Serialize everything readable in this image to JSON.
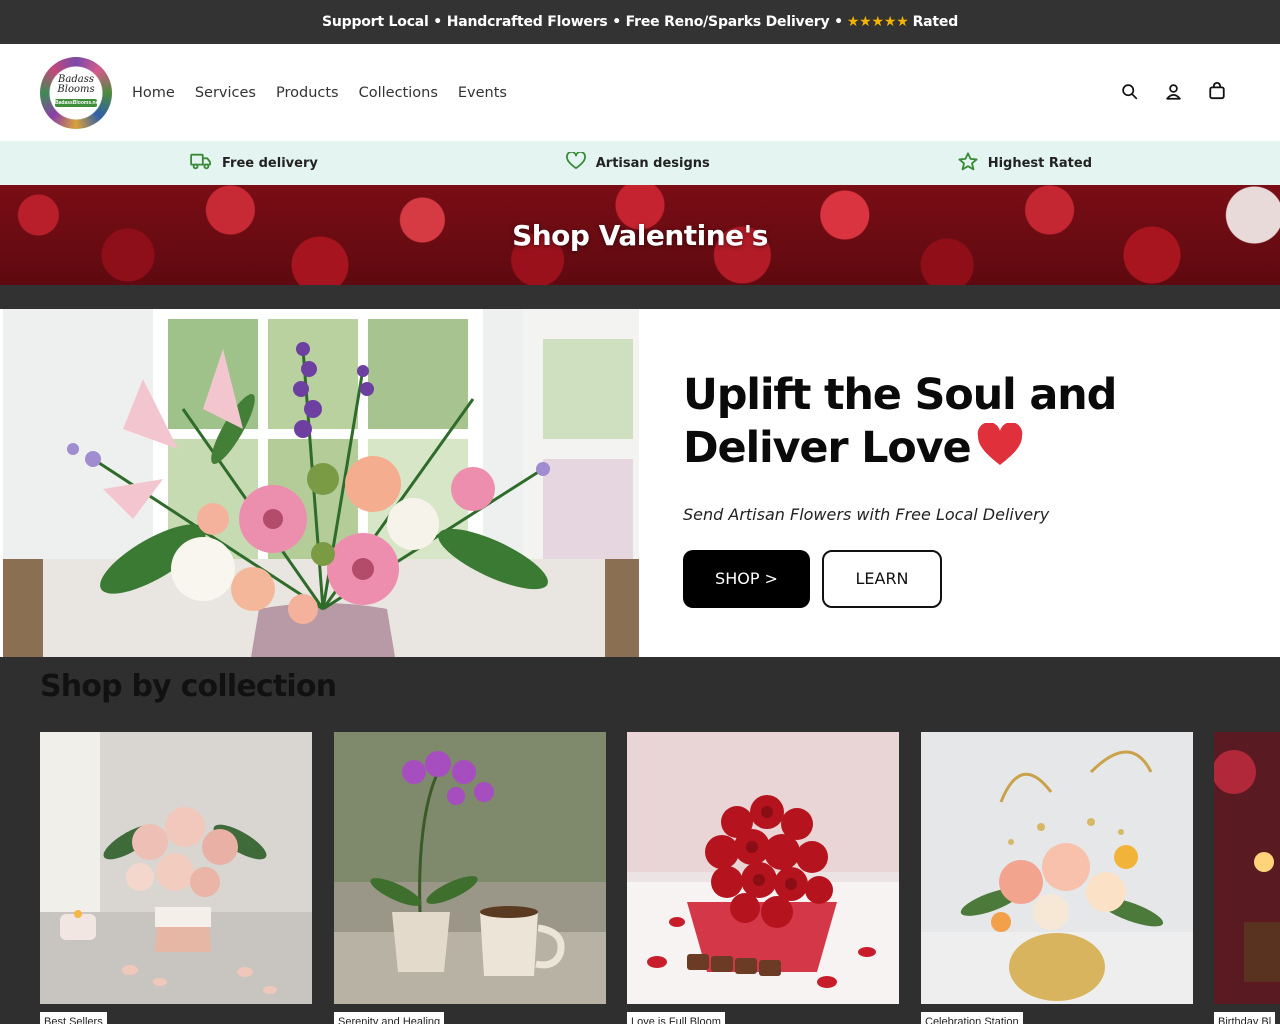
{
  "announcement": {
    "text_before": "Support Local • Handcrafted Flowers • Free Reno/Sparks Delivery •",
    "stars": "★★★★★",
    "text_after": "Rated"
  },
  "logo": {
    "line1": "Badass",
    "line2": "Blooms",
    "tag": "BadassBlooms.net"
  },
  "nav": {
    "items": [
      "Home",
      "Services",
      "Products",
      "Collections",
      "Events"
    ]
  },
  "header_icons": [
    "search-icon",
    "account-icon",
    "cart-icon"
  ],
  "features": [
    {
      "icon": "truck-icon",
      "label": "Free delivery"
    },
    {
      "icon": "heart-outline-icon",
      "label": "Artisan designs"
    },
    {
      "icon": "star-outline-icon",
      "label": "Highest Rated"
    }
  ],
  "banner": {
    "title": "Shop Valentine's"
  },
  "hero": {
    "title": "Uplift the Soul and Deliver Love",
    "subtitle": "Send Artisan Flowers with Free Local Delivery",
    "shop_label": "SHOP >",
    "learn_label": "LEARN"
  },
  "collections": {
    "heading": "Shop by collection",
    "items": [
      {
        "label": "Best Sellers"
      },
      {
        "label": "Serenity and Healing"
      },
      {
        "label": "Love is Full Bloom"
      },
      {
        "label": "Celebration Station"
      },
      {
        "label": "Birthday Bl"
      }
    ]
  },
  "colors": {
    "announcement_bg": "#333333",
    "feature_bar_bg": "#e4f4f0",
    "feature_icon": "#3a8a3a",
    "hero_button_bg": "#000000",
    "heart": "#e0303c",
    "collections_bg": "#2f2f2f"
  }
}
